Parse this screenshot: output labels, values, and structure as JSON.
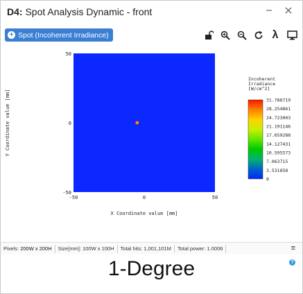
{
  "window": {
    "title_prefix": "D4:",
    "title_text": " Spot Analysis Dynamic - front"
  },
  "toolbar": {
    "spot_label": "Spot (Incoherent Irradiance)",
    "icons": [
      "unlock-icon",
      "zoom-in-icon",
      "zoom-out-icon",
      "refresh-icon",
      "lambda-icon",
      "monitor-icon"
    ]
  },
  "chart_data": {
    "type": "heatmap",
    "xlabel": "X Coordinate value [mm]",
    "ylabel": "Y Coordinate value [mm]",
    "xlim": [
      -50,
      50
    ],
    "ylim": [
      -50,
      50
    ],
    "x_ticks": [
      "-50",
      "0",
      "50"
    ],
    "y_ticks": [
      "50",
      "0",
      "-50"
    ],
    "background_color": "#0a28ff",
    "spot": {
      "x": -5,
      "y": 0,
      "value": 31.786719
    },
    "colorbar_title": [
      "Incoherent",
      "Irradiance",
      "[W/cm^2]"
    ],
    "colorbar_ticks": [
      "31.786719",
      "28.254861",
      "24.723003",
      "21.191146",
      "17.659288",
      "14.127431",
      "10.595573",
      "7.063715",
      "3.531858",
      "0"
    ],
    "colorbar_colors": [
      "#ff1400",
      "#ff8000",
      "#ffd200",
      "#c8f000",
      "#64e600",
      "#00c800",
      "#00b46e",
      "#0064c8",
      "#0028ff"
    ]
  },
  "status": {
    "pixels_label": "Pixels:",
    "pixels_value": "200W x 200H",
    "size_label": "Size[mm]:",
    "size_value": "100W x 100H",
    "hits_label": "Total hits:",
    "hits_value": "1,001,101M",
    "power_label": "Total power:",
    "power_value": "1.0006"
  },
  "caption": "1-Degree",
  "colors": {
    "accent": "#3b7fd4",
    "help": "#2f9be0"
  }
}
